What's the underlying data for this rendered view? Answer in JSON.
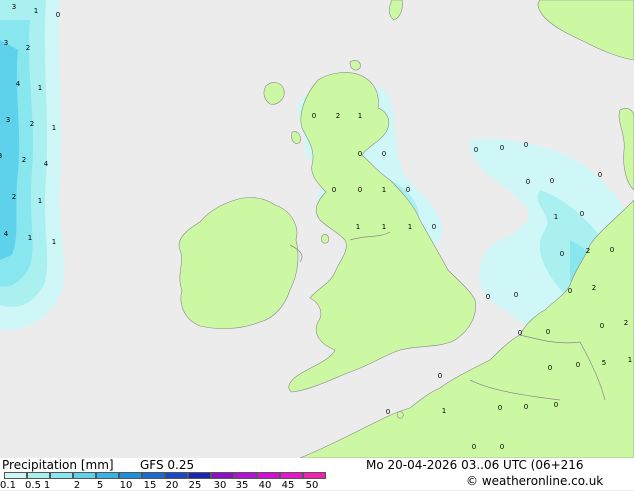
{
  "footer": {
    "title": "Precipitation [mm]",
    "model": "GFS 0.25",
    "datetime": "Mo 20-04-2026 03..06 UTC (06+216",
    "credit": "© weatheronline.co.uk"
  },
  "legend": {
    "ticks": [
      "0.1",
      "0.5",
      "1",
      "2",
      "5",
      "10",
      "15",
      "20",
      "25",
      "30",
      "35",
      "40",
      "45",
      "50"
    ],
    "colors": [
      "#d0f7f7",
      "#aaf0f0",
      "#88e6ee",
      "#5ed2ea",
      "#38b4e4",
      "#2090da",
      "#1a6cd2",
      "#1a48c4",
      "#1a26b0",
      "#8a10c8",
      "#b410d2",
      "#d010d6",
      "#e018c8",
      "#f020b0"
    ]
  },
  "colors": {
    "sea": "#ececec",
    "land": "#ccf7a3",
    "border": "#8a8a8a"
  },
  "map_labels": [
    {
      "t": "3"
    },
    {
      "t": "1"
    },
    {
      "t": "0"
    },
    {
      "t": "3"
    },
    {
      "t": "2"
    },
    {
      "t": "4"
    },
    {
      "t": "1"
    },
    {
      "t": "3"
    },
    {
      "t": "2"
    },
    {
      "t": "1"
    },
    {
      "t": "3"
    },
    {
      "t": "2"
    },
    {
      "t": "4"
    },
    {
      "t": "2"
    },
    {
      "t": "1"
    },
    {
      "t": "4"
    },
    {
      "t": "1"
    },
    {
      "t": "1"
    },
    {
      "t": "0"
    },
    {
      "t": "2"
    },
    {
      "t": "1"
    },
    {
      "t": "0"
    },
    {
      "t": "0"
    },
    {
      "t": "0"
    },
    {
      "t": "0"
    },
    {
      "t": "1"
    },
    {
      "t": "0"
    },
    {
      "t": "1"
    },
    {
      "t": "1"
    },
    {
      "t": "1"
    },
    {
      "t": "0"
    },
    {
      "t": "0"
    },
    {
      "t": "0"
    },
    {
      "t": "0"
    },
    {
      "t": "0"
    },
    {
      "t": "0"
    },
    {
      "t": "0"
    },
    {
      "t": "1"
    },
    {
      "t": "0"
    },
    {
      "t": "0"
    },
    {
      "t": "2"
    },
    {
      "t": "0"
    },
    {
      "t": "0"
    },
    {
      "t": "2"
    },
    {
      "t": "0"
    },
    {
      "t": "0"
    },
    {
      "t": "0"
    },
    {
      "t": "2"
    },
    {
      "t": "0"
    },
    {
      "t": "0"
    },
    {
      "t": "0"
    },
    {
      "t": "0"
    },
    {
      "t": "0"
    },
    {
      "t": "1"
    },
    {
      "t": "0"
    },
    {
      "t": "0"
    },
    {
      "t": "0"
    },
    {
      "t": "0"
    },
    {
      "t": "0"
    },
    {
      "t": "0"
    },
    {
      "t": "5"
    },
    {
      "t": "1"
    }
  ]
}
